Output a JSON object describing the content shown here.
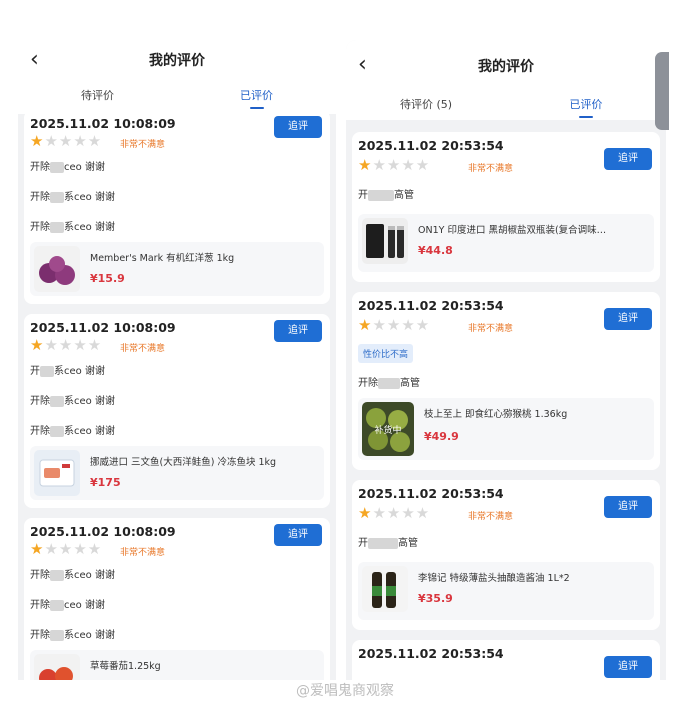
{
  "left": {
    "back_icon": "‹",
    "title": "我的评价",
    "tabs": [
      "待评价",
      "已评价"
    ],
    "active_tab": 1,
    "reviews": [
      {
        "date": "2025.11.02 10:08:09",
        "rating_label": "非常不满意",
        "action": "追评",
        "comments": [
          [
            "开除",
            "ceo 谢谢"
          ],
          [
            "开除",
            "系ceo 谢谢"
          ],
          [
            "开除",
            "系ceo 谢谢"
          ]
        ],
        "product": {
          "name": "Member's Mark 有机红洋葱  1kg",
          "price": "¥15.9"
        }
      },
      {
        "date": "2025.11.02 10:08:09",
        "rating_label": "非常不满意",
        "action": "追评",
        "comments": [
          [
            "开",
            "系ceo 谢谢"
          ],
          [
            "开除",
            "系ceo 谢谢"
          ],
          [
            "开除",
            "系ceo 谢谢"
          ]
        ],
        "product": {
          "name": "挪威进口 三文鱼(大西洋鲑鱼) 冷冻鱼块 1kg",
          "price": "¥175"
        }
      },
      {
        "date": "2025.11.02 10:08:09",
        "rating_label": "非常不满意",
        "action": "追评",
        "comments": [
          [
            "开除",
            "系ceo 谢谢"
          ],
          [
            "开除",
            "ceo 谢谢"
          ],
          [
            "开除",
            "系ceo 谢谢"
          ]
        ],
        "product": {
          "name": "草莓番茄1.25kg",
          "price": ""
        }
      }
    ]
  },
  "right": {
    "back_icon": "‹",
    "title": "我的评价",
    "tabs": [
      "待评价 (5)",
      "已评价"
    ],
    "active_tab": 1,
    "reviews": [
      {
        "date": "2025.11.02 20:53:54",
        "rating_label": "非常不满意",
        "action": "追评",
        "tag": "",
        "comment": [
          "开",
          "高管"
        ],
        "product": {
          "name": "ON1Y 印度进口 黑胡椒盐双瓶装(复合调味…",
          "price": "¥44.8"
        }
      },
      {
        "date": "2025.11.02 20:53:54",
        "rating_label": "非常不满意",
        "action": "追评",
        "tag": "性价比不高",
        "comment": [
          "开除",
          "高管"
        ],
        "product": {
          "name": "枝上至上 即食红心猕猴桃 1.36kg",
          "price": "¥49.9",
          "thumb_text": "补货中"
        }
      },
      {
        "date": "2025.11.02 20:53:54",
        "rating_label": "非常不满意",
        "action": "追评",
        "tag": "",
        "comment": [
          "开",
          "高管"
        ],
        "product": {
          "name": "李锦记 特级薄盐头抽酿造酱油 1L*2",
          "price": "¥35.9"
        }
      },
      {
        "date": "2025.11.02 20:53:54",
        "action": "追评"
      }
    ]
  },
  "watermark": "@爱唱鬼商观察",
  "colors": {
    "accent_blue": "#1f6ed4",
    "star_on": "#f5a623",
    "star_off": "#d9d9d9",
    "rating_text": "#e8782a",
    "price": "#d9363e"
  }
}
